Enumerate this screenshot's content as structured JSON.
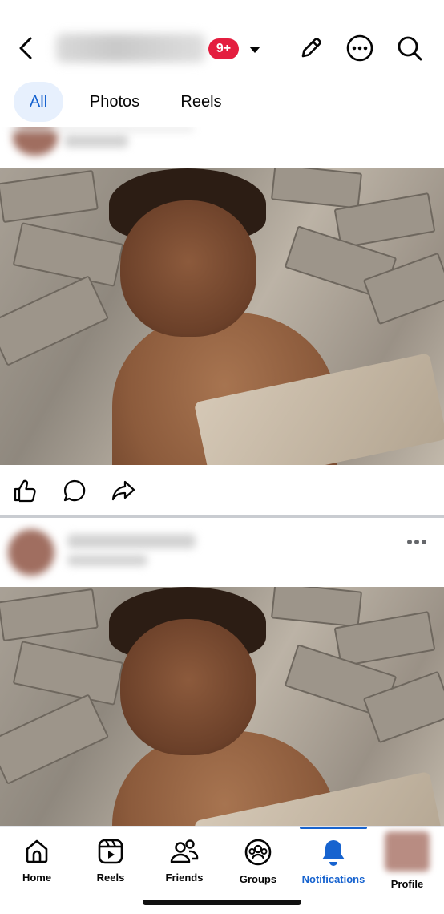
{
  "header": {
    "notification_badge": "9+",
    "icons": [
      "back-arrow-icon",
      "chevron-down-icon",
      "pencil-icon",
      "more-icon",
      "search-icon"
    ]
  },
  "tabs": [
    {
      "label": "All",
      "active": true
    },
    {
      "label": "Photos",
      "active": false
    },
    {
      "label": "Reels",
      "active": false
    }
  ],
  "post_actions": [
    "like-icon",
    "comment-icon",
    "share-icon"
  ],
  "bottom_nav": [
    {
      "label": "Home",
      "icon": "home-icon",
      "active": false
    },
    {
      "label": "Reels",
      "icon": "reels-icon",
      "active": false
    },
    {
      "label": "Friends",
      "icon": "friends-icon",
      "active": false
    },
    {
      "label": "Groups",
      "icon": "groups-icon",
      "active": false
    },
    {
      "label": "Notifications",
      "icon": "bell-icon",
      "active": true
    },
    {
      "label": "Profile",
      "icon": "profile-avatar",
      "active": false
    }
  ],
  "colors": {
    "accent": "#1763cf",
    "badge": "#e41e3f",
    "active_tab_bg": "#e7f0fd"
  }
}
